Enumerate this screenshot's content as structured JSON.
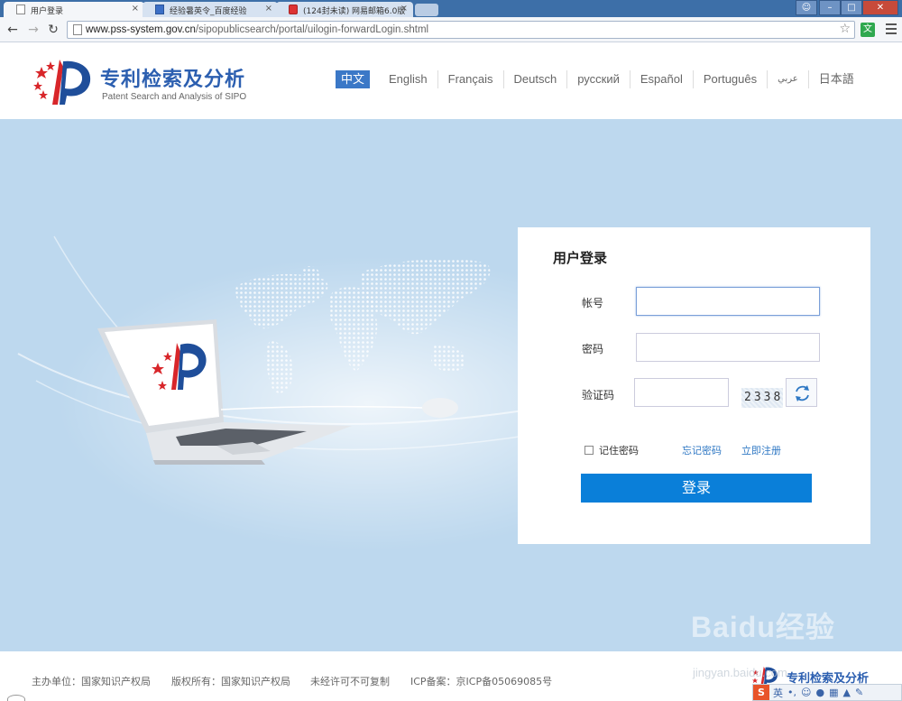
{
  "browser": {
    "tabs": [
      {
        "title": "用户登录",
        "active": true
      },
      {
        "title": "经验暑英令_百度经验",
        "active": false
      },
      {
        "title": "(124封未读) 网易邮箱6.0版",
        "active": false
      }
    ],
    "tab_close": "×",
    "url_host": "www.pss-system.gov.cn",
    "url_path": "/sipopublicsearch/portal/uilogin-forwardLogin.shtml",
    "ext_label": "文",
    "icons": [
      "back-icon",
      "forward-icon",
      "reload-icon",
      "star-icon",
      "menu-icon"
    ]
  },
  "header": {
    "title": "专利检索及分析",
    "subtitle": "Patent Search and Analysis of SIPO",
    "languages": [
      {
        "label": "中文",
        "active": true
      },
      {
        "label": "English"
      },
      {
        "label": "Français"
      },
      {
        "label": "Deutsch"
      },
      {
        "label": "русский"
      },
      {
        "label": "Español"
      },
      {
        "label": "Português"
      },
      {
        "label": "عربي"
      },
      {
        "label": "日本語"
      }
    ]
  },
  "login": {
    "title": "用户登录",
    "account_label": "帐号",
    "password_label": "密码",
    "captcha_label": "验证码",
    "captcha_text": "2338",
    "remember_label": "记住密码",
    "forgot_label": "忘记密码",
    "register_label": "立即注册",
    "submit_label": "登录"
  },
  "footer": {
    "host": "主办单位：国家知识产权局",
    "copyright": "版权所有：国家知识产权局",
    "no_copy": "未经许可不可复制",
    "icp": "ICP备案：京ICP备05069085号",
    "brand": "专利检索及分析"
  },
  "watermark": {
    "text": "Baidu经验",
    "sub": "jingyan.baidu.com"
  },
  "ime": {
    "logo": "S",
    "mode": "英"
  },
  "colors": {
    "banner": "#bdd8ee",
    "accent": "#0a7fd9",
    "brand": "#2c5fb0",
    "link": "#2f78c4"
  }
}
